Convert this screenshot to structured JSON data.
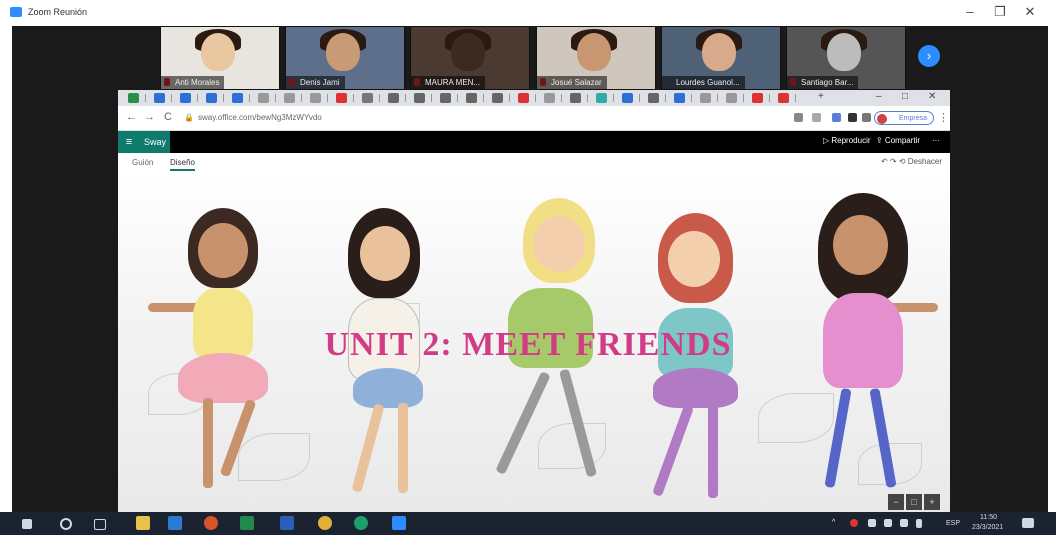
{
  "window": {
    "title": "Zoom Reunión",
    "minimize": "–",
    "maximize": "❐",
    "close": "✕"
  },
  "participants": [
    {
      "name": "Anti Morales",
      "bg": "#e8e4df",
      "skin": "#e9c7a0"
    },
    {
      "name": "Denis Jami",
      "bg": "#5d6f8a",
      "skin": "#c99a76"
    },
    {
      "name": "MAURA MEN...",
      "bg": "#4a3a32",
      "skin": "#3a2a22"
    },
    {
      "name": "Josué Salazar",
      "bg": "#cfc6bd",
      "skin": "#c89772"
    },
    {
      "name": "Lourdes Guanol...",
      "bg": "#4e6176",
      "skin": "#d8a98a"
    },
    {
      "name": "Santiago Bar...",
      "bg": "#555555",
      "skin": "#bcbcbc"
    }
  ],
  "next_participants_icon": "chevron-right-icon",
  "browser": {
    "url": "sway.office.com/bewNg3MzWYvdo",
    "profile_label": "Empresa",
    "nav_back": "←",
    "nav_forward": "→",
    "nav_reload": "C",
    "new_tab": "+"
  },
  "sway": {
    "logo": "Sway",
    "menu_icon": "≡",
    "play": "▷ Reproducir",
    "share": "⇪ Compartir",
    "more": "···",
    "tabs": [
      "Guión",
      "Diseño"
    ],
    "active_tab": 1,
    "undo": "↶ ↷  ⟲ Deshacer"
  },
  "slide": {
    "headline": "UNIT 2: MEET FRIENDS"
  },
  "zoom_controls": [
    "−",
    "□",
    "+"
  ],
  "taskbar": {
    "lang": "ESP",
    "time": "11:50",
    "date": "23/3/2021"
  },
  "colors": {
    "zoom_blue": "#2d8cff",
    "sway_green": "#0f7b6c",
    "headline": "#d23c86"
  }
}
